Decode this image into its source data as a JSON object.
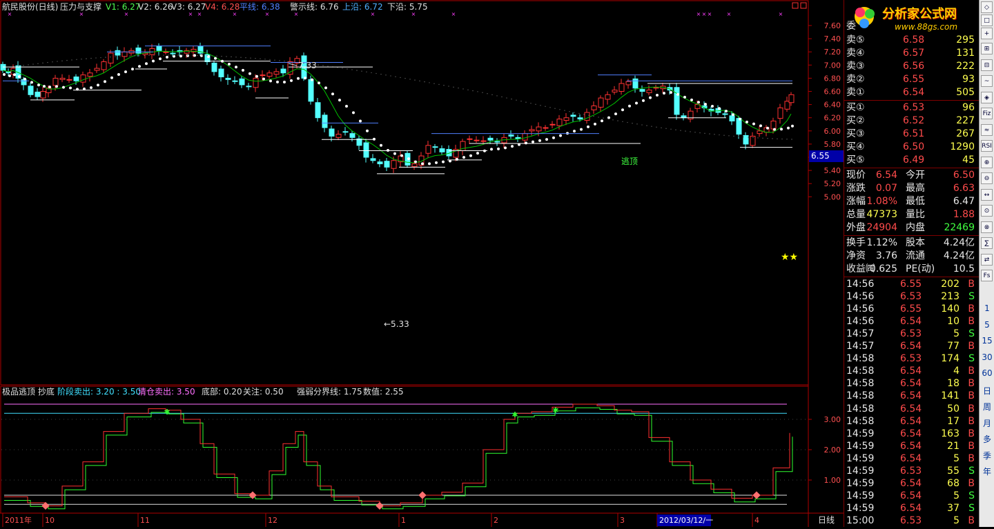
{
  "header": {
    "stock": "航民股份(日线)",
    "indicator": "压力与支撑",
    "v1": "V1: 6.27",
    "v2": "V2: 6.26",
    "v3": "V3: 6.27",
    "v4": "V4: 6.28",
    "balance": "平线: 6.38",
    "alert": "警示线: 6.76",
    "upper": "上沿: 6.72",
    "lower": "下沿: 5.75"
  },
  "sub_header": {
    "name": "极品逃顶 抄底",
    "stage": "阶段卖出: 3.20 : 3.50",
    "clear": "清仓卖出: 3.50",
    "bottom": "底部: 0.20",
    "watch": "关注: 0.50",
    "divider": "强弱分界线: 1.75",
    "value": "数值: 2.55"
  },
  "annotations": {
    "high": "7.33",
    "low": "←5.33",
    "escape": "逃顶",
    "stars": "★★",
    "current_price": "6.55"
  },
  "price_axis": [
    "7.60",
    "7.40",
    "7.20",
    "7.00",
    "6.80",
    "6.60",
    "6.40",
    "6.20",
    "6.00",
    "5.80",
    "5.60",
    "5.40",
    "5.20",
    "5.00"
  ],
  "osc_axis": [
    "3.00",
    "2.00",
    "1.00"
  ],
  "date_axis": [
    "2011年",
    "10",
    "11",
    "12",
    "1",
    "2",
    "3",
    "2012/03/12/一",
    "4"
  ],
  "period_label": "日线",
  "colors": {
    "up": "#ff3232",
    "down": "#54ffff",
    "dots": "#ffffff",
    "ma": "#00c000",
    "border": "#b00000"
  },
  "logo": {
    "title": "分析家公式网",
    "url": "www.88gs.com"
  },
  "orderbook": {
    "title": "委",
    "asks": [
      {
        "label": "卖⑤",
        "price": "6.58",
        "vol": "295"
      },
      {
        "label": "卖④",
        "price": "6.57",
        "vol": "131"
      },
      {
        "label": "卖③",
        "price": "6.56",
        "vol": "222"
      },
      {
        "label": "卖②",
        "price": "6.55",
        "vol": "93"
      },
      {
        "label": "卖①",
        "price": "6.54",
        "vol": "505"
      }
    ],
    "bids": [
      {
        "label": "买①",
        "price": "6.53",
        "vol": "96"
      },
      {
        "label": "买②",
        "price": "6.52",
        "vol": "227"
      },
      {
        "label": "买③",
        "price": "6.51",
        "vol": "267"
      },
      {
        "label": "买④",
        "price": "6.50",
        "vol": "1290"
      },
      {
        "label": "买⑤",
        "price": "6.49",
        "vol": "45"
      }
    ]
  },
  "stats": [
    {
      "l1": "现价",
      "v1": "6.54",
      "l2": "今开",
      "v2": "6.50",
      "c1": "red",
      "c2": "red"
    },
    {
      "l1": "涨跌",
      "v1": "0.07",
      "l2": "最高",
      "v2": "6.63",
      "c1": "red",
      "c2": "red"
    },
    {
      "l1": "涨幅",
      "v1": "1.08%",
      "l2": "最低",
      "v2": "6.47",
      "c1": "red",
      "c2": "white"
    },
    {
      "l1": "总量",
      "v1": "47373",
      "l2": "量比",
      "v2": "1.88",
      "c1": "yellow",
      "c2": "red"
    },
    {
      "l1": "外盘",
      "v1": "24904",
      "l2": "内盘",
      "v2": "22469",
      "c1": "red",
      "c2": "green"
    }
  ],
  "stats2": [
    {
      "l1": "换手",
      "v1": "1.12%",
      "l2": "股本",
      "v2": "4.24亿"
    },
    {
      "l1": "净资",
      "v1": "3.76",
      "l2": "流通",
      "v2": "4.24亿"
    },
    {
      "l1": "收益㈣",
      "v1": "0.625",
      "l2": "PE(动)",
      "v2": "10.5"
    }
  ],
  "ticks": [
    {
      "t": "14:56",
      "p": "6.55",
      "v": "202",
      "s": "B"
    },
    {
      "t": "14:56",
      "p": "6.53",
      "v": "213",
      "s": "S"
    },
    {
      "t": "14:56",
      "p": "6.55",
      "v": "140",
      "s": "B"
    },
    {
      "t": "14:56",
      "p": "6.54",
      "v": "10",
      "s": "B"
    },
    {
      "t": "14:57",
      "p": "6.53",
      "v": "5",
      "s": "S"
    },
    {
      "t": "14:57",
      "p": "6.54",
      "v": "77",
      "s": "B"
    },
    {
      "t": "14:58",
      "p": "6.53",
      "v": "174",
      "s": "S"
    },
    {
      "t": "14:58",
      "p": "6.54",
      "v": "4",
      "s": "B"
    },
    {
      "t": "14:58",
      "p": "6.54",
      "v": "18",
      "s": "B"
    },
    {
      "t": "14:58",
      "p": "6.54",
      "v": "141",
      "s": "B"
    },
    {
      "t": "14:58",
      "p": "6.54",
      "v": "50",
      "s": "B"
    },
    {
      "t": "14:58",
      "p": "6.54",
      "v": "17",
      "s": "B"
    },
    {
      "t": "14:59",
      "p": "6.54",
      "v": "163",
      "s": "B"
    },
    {
      "t": "14:59",
      "p": "6.54",
      "v": "21",
      "s": "B"
    },
    {
      "t": "14:59",
      "p": "6.54",
      "v": "5",
      "s": "B"
    },
    {
      "t": "14:59",
      "p": "6.53",
      "v": "55",
      "s": "S"
    },
    {
      "t": "14:59",
      "p": "6.54",
      "v": "68",
      "s": "B"
    },
    {
      "t": "14:59",
      "p": "6.54",
      "v": "5",
      "s": "S"
    },
    {
      "t": "14:59",
      "p": "6.54",
      "v": "37",
      "s": "S"
    },
    {
      "t": "15:00",
      "p": "6.53",
      "v": "5",
      "s": "B"
    }
  ],
  "toolbar": {
    "btn1": "◇",
    "btn2": "□",
    "btn3": "+",
    "icons": [
      "⊞",
      "⊟",
      "~",
      "◈",
      "Fiz",
      "≈",
      "RSI",
      "⊕",
      "⊖",
      "↔",
      "⊙",
      "⊗",
      "∑",
      "⇄",
      "Fs"
    ],
    "periods": [
      "1",
      "5",
      "15",
      "30",
      "60",
      "日",
      "周",
      "月",
      "多",
      "季",
      "年"
    ]
  }
}
